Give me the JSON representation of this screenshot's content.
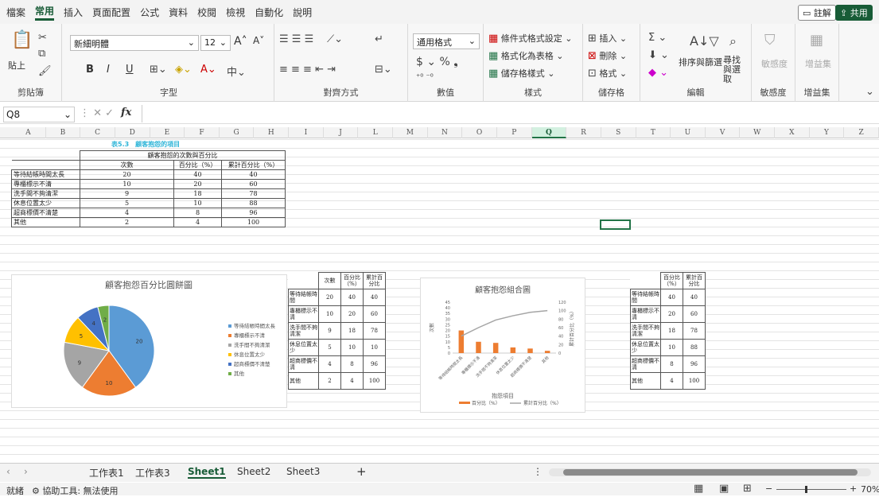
{
  "menu": {
    "items": [
      "檔案",
      "常用",
      "插入",
      "頁面配置",
      "公式",
      "資料",
      "校閱",
      "檢視",
      "自動化",
      "說明"
    ],
    "comment": "註解",
    "share": "共用"
  },
  "ribbon": {
    "clipboard": {
      "paste": "貼上",
      "label": "剪貼簿"
    },
    "font": {
      "name": "新細明體",
      "size": "12",
      "bold": "B",
      "italic": "I",
      "underline": "U",
      "label": "字型"
    },
    "align": {
      "label": "對齊方式"
    },
    "number": {
      "format": "通用格式",
      "label": "數值"
    },
    "styles": {
      "cond": "條件式格式設定",
      "table": "格式化為表格",
      "cell": "儲存格樣式",
      "label": "樣式"
    },
    "cells": {
      "insert": "插入",
      "delete": "刪除",
      "format": "格式",
      "label": "儲存格"
    },
    "edit": {
      "sort": "排序與篩選",
      "find": "尋找與選取",
      "label": "編輯"
    },
    "sens": {
      "btn": "敏感度",
      "label": "敏感度"
    },
    "addin": {
      "btn": "增益集",
      "label": "增益集"
    }
  },
  "formula": {
    "namebox": "Q8",
    "fx": "fx"
  },
  "columns": [
    "A",
    "B",
    "C",
    "D",
    "E",
    "F",
    "G",
    "H",
    "I",
    "J",
    "L",
    "M",
    "N",
    "O",
    "P",
    "Q",
    "R",
    "S",
    "T",
    "U",
    "V",
    "W",
    "X",
    "Y",
    "Z"
  ],
  "table1": {
    "caption": "表5.3　顧客抱怨的項目",
    "header": "顧客抱怨的次數與百分比",
    "cols": [
      "次數",
      "百分比（%）",
      "累計百分比（%）"
    ],
    "rows": [
      [
        "等待結帳時間太長",
        "20",
        "40",
        "40"
      ],
      [
        "專櫃標示不清",
        "10",
        "20",
        "60"
      ],
      [
        "洗手間不夠清潔",
        "9",
        "18",
        "78"
      ],
      [
        "休息位置太少",
        "5",
        "10",
        "88"
      ],
      [
        "超商標價不清楚",
        "4",
        "8",
        "96"
      ],
      [
        "其他",
        "2",
        "4",
        "100"
      ]
    ]
  },
  "mini1": {
    "cols": [
      "次數",
      "百分比（%）",
      "累計百分比"
    ],
    "rows": [
      [
        "等待結帳時間",
        "20",
        "40",
        "40"
      ],
      [
        "專櫃標示不清",
        "10",
        "20",
        "60"
      ],
      [
        "洗手間不夠清潔",
        "9",
        "18",
        "78"
      ],
      [
        "休息位置太少",
        "5",
        "10",
        "10"
      ],
      [
        "超商標價不清",
        "4",
        "8",
        "96"
      ],
      [
        "其他",
        "2",
        "4",
        "100"
      ]
    ]
  },
  "mini2": {
    "cols": [
      "百分比（%）",
      "累計百分比"
    ],
    "rows": [
      [
        "等待結帳時間",
        "40",
        "40"
      ],
      [
        "專櫃標示不清",
        "20",
        "60"
      ],
      [
        "洗手間不夠清潔",
        "18",
        "78"
      ],
      [
        "休息位置太少",
        "10",
        "88"
      ],
      [
        "超商標價不清",
        "8",
        "96"
      ],
      [
        "其他",
        "4",
        "100"
      ]
    ]
  },
  "chart_data": [
    {
      "type": "pie",
      "title": "顧客抱怨百分比圓餅圖",
      "categories": [
        "等待結帳時間太長",
        "專櫃標示不清",
        "洗手間不夠清潔",
        "休息位置太少",
        "超商標價不清楚",
        "其他"
      ],
      "values": [
        20,
        10,
        9,
        5,
        4,
        2
      ],
      "colors": [
        "#5b9bd5",
        "#ed7d31",
        "#a5a5a5",
        "#ffc000",
        "#4472c4",
        "#70ad47"
      ],
      "legend": "right"
    },
    {
      "type": "bar",
      "title": "顧客抱怨組合圖",
      "categories": [
        "等待結帳時間太長",
        "專櫃標示不清",
        "洗手間不夠清潔",
        "休息位置太少",
        "超商標價不清楚",
        "其他"
      ],
      "series": [
        {
          "name": "百分比（%）",
          "values": [
            20,
            10,
            9,
            5,
            4,
            2
          ],
          "color": "#ed7d31"
        },
        {
          "name": "累計百分比（%）",
          "values": [
            40,
            60,
            78,
            88,
            96,
            100
          ],
          "color": "#a5a5a5"
        }
      ],
      "ylim": [
        0,
        45
      ],
      "y2lim": [
        0,
        120
      ],
      "yticks": [
        "45",
        "40",
        "35",
        "30",
        "25",
        "20",
        "15",
        "10",
        "5",
        "0"
      ],
      "y2ticks": [
        "120",
        "100",
        "80",
        "60",
        "40",
        "20",
        "0"
      ],
      "ylabel": "次數",
      "y2label": "累計百分比（%）",
      "xlabel": "抱怨項目"
    }
  ],
  "tabs": [
    "工作表1",
    "工作表3",
    "Sheet1",
    "Sheet2",
    "Sheet3"
  ],
  "status": {
    "ready": "就緒",
    "access": "協助工具: 無法使用",
    "zoom": "70%"
  }
}
